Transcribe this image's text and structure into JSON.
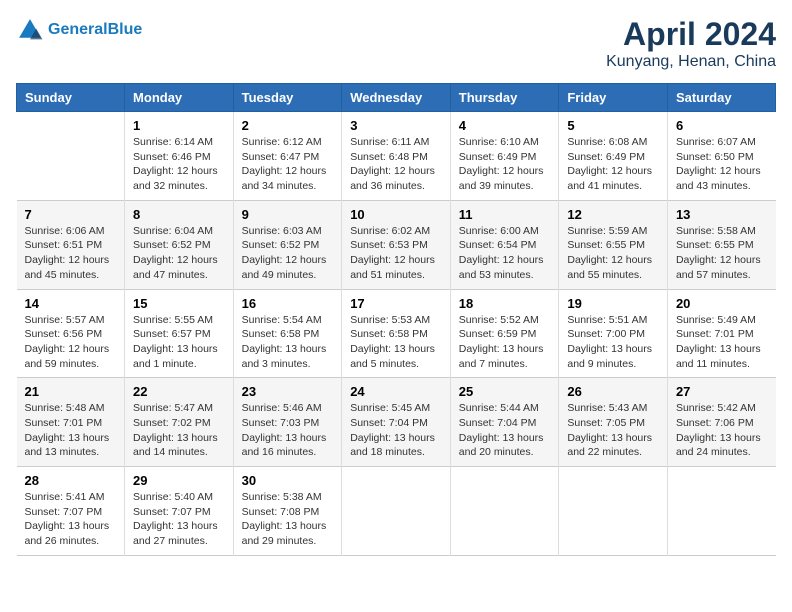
{
  "header": {
    "logo_line1": "General",
    "logo_line2": "Blue",
    "title": "April 2024",
    "subtitle": "Kunyang, Henan, China"
  },
  "days_of_week": [
    "Sunday",
    "Monday",
    "Tuesday",
    "Wednesday",
    "Thursday",
    "Friday",
    "Saturday"
  ],
  "weeks": [
    [
      {
        "day": "",
        "info": ""
      },
      {
        "day": "1",
        "info": "Sunrise: 6:14 AM\nSunset: 6:46 PM\nDaylight: 12 hours\nand 32 minutes."
      },
      {
        "day": "2",
        "info": "Sunrise: 6:12 AM\nSunset: 6:47 PM\nDaylight: 12 hours\nand 34 minutes."
      },
      {
        "day": "3",
        "info": "Sunrise: 6:11 AM\nSunset: 6:48 PM\nDaylight: 12 hours\nand 36 minutes."
      },
      {
        "day": "4",
        "info": "Sunrise: 6:10 AM\nSunset: 6:49 PM\nDaylight: 12 hours\nand 39 minutes."
      },
      {
        "day": "5",
        "info": "Sunrise: 6:08 AM\nSunset: 6:49 PM\nDaylight: 12 hours\nand 41 minutes."
      },
      {
        "day": "6",
        "info": "Sunrise: 6:07 AM\nSunset: 6:50 PM\nDaylight: 12 hours\nand 43 minutes."
      }
    ],
    [
      {
        "day": "7",
        "info": "Sunrise: 6:06 AM\nSunset: 6:51 PM\nDaylight: 12 hours\nand 45 minutes."
      },
      {
        "day": "8",
        "info": "Sunrise: 6:04 AM\nSunset: 6:52 PM\nDaylight: 12 hours\nand 47 minutes."
      },
      {
        "day": "9",
        "info": "Sunrise: 6:03 AM\nSunset: 6:52 PM\nDaylight: 12 hours\nand 49 minutes."
      },
      {
        "day": "10",
        "info": "Sunrise: 6:02 AM\nSunset: 6:53 PM\nDaylight: 12 hours\nand 51 minutes."
      },
      {
        "day": "11",
        "info": "Sunrise: 6:00 AM\nSunset: 6:54 PM\nDaylight: 12 hours\nand 53 minutes."
      },
      {
        "day": "12",
        "info": "Sunrise: 5:59 AM\nSunset: 6:55 PM\nDaylight: 12 hours\nand 55 minutes."
      },
      {
        "day": "13",
        "info": "Sunrise: 5:58 AM\nSunset: 6:55 PM\nDaylight: 12 hours\nand 57 minutes."
      }
    ],
    [
      {
        "day": "14",
        "info": "Sunrise: 5:57 AM\nSunset: 6:56 PM\nDaylight: 12 hours\nand 59 minutes."
      },
      {
        "day": "15",
        "info": "Sunrise: 5:55 AM\nSunset: 6:57 PM\nDaylight: 13 hours\nand 1 minute."
      },
      {
        "day": "16",
        "info": "Sunrise: 5:54 AM\nSunset: 6:58 PM\nDaylight: 13 hours\nand 3 minutes."
      },
      {
        "day": "17",
        "info": "Sunrise: 5:53 AM\nSunset: 6:58 PM\nDaylight: 13 hours\nand 5 minutes."
      },
      {
        "day": "18",
        "info": "Sunrise: 5:52 AM\nSunset: 6:59 PM\nDaylight: 13 hours\nand 7 minutes."
      },
      {
        "day": "19",
        "info": "Sunrise: 5:51 AM\nSunset: 7:00 PM\nDaylight: 13 hours\nand 9 minutes."
      },
      {
        "day": "20",
        "info": "Sunrise: 5:49 AM\nSunset: 7:01 PM\nDaylight: 13 hours\nand 11 minutes."
      }
    ],
    [
      {
        "day": "21",
        "info": "Sunrise: 5:48 AM\nSunset: 7:01 PM\nDaylight: 13 hours\nand 13 minutes."
      },
      {
        "day": "22",
        "info": "Sunrise: 5:47 AM\nSunset: 7:02 PM\nDaylight: 13 hours\nand 14 minutes."
      },
      {
        "day": "23",
        "info": "Sunrise: 5:46 AM\nSunset: 7:03 PM\nDaylight: 13 hours\nand 16 minutes."
      },
      {
        "day": "24",
        "info": "Sunrise: 5:45 AM\nSunset: 7:04 PM\nDaylight: 13 hours\nand 18 minutes."
      },
      {
        "day": "25",
        "info": "Sunrise: 5:44 AM\nSunset: 7:04 PM\nDaylight: 13 hours\nand 20 minutes."
      },
      {
        "day": "26",
        "info": "Sunrise: 5:43 AM\nSunset: 7:05 PM\nDaylight: 13 hours\nand 22 minutes."
      },
      {
        "day": "27",
        "info": "Sunrise: 5:42 AM\nSunset: 7:06 PM\nDaylight: 13 hours\nand 24 minutes."
      }
    ],
    [
      {
        "day": "28",
        "info": "Sunrise: 5:41 AM\nSunset: 7:07 PM\nDaylight: 13 hours\nand 26 minutes."
      },
      {
        "day": "29",
        "info": "Sunrise: 5:40 AM\nSunset: 7:07 PM\nDaylight: 13 hours\nand 27 minutes."
      },
      {
        "day": "30",
        "info": "Sunrise: 5:38 AM\nSunset: 7:08 PM\nDaylight: 13 hours\nand 29 minutes."
      },
      {
        "day": "",
        "info": ""
      },
      {
        "day": "",
        "info": ""
      },
      {
        "day": "",
        "info": ""
      },
      {
        "day": "",
        "info": ""
      }
    ]
  ]
}
